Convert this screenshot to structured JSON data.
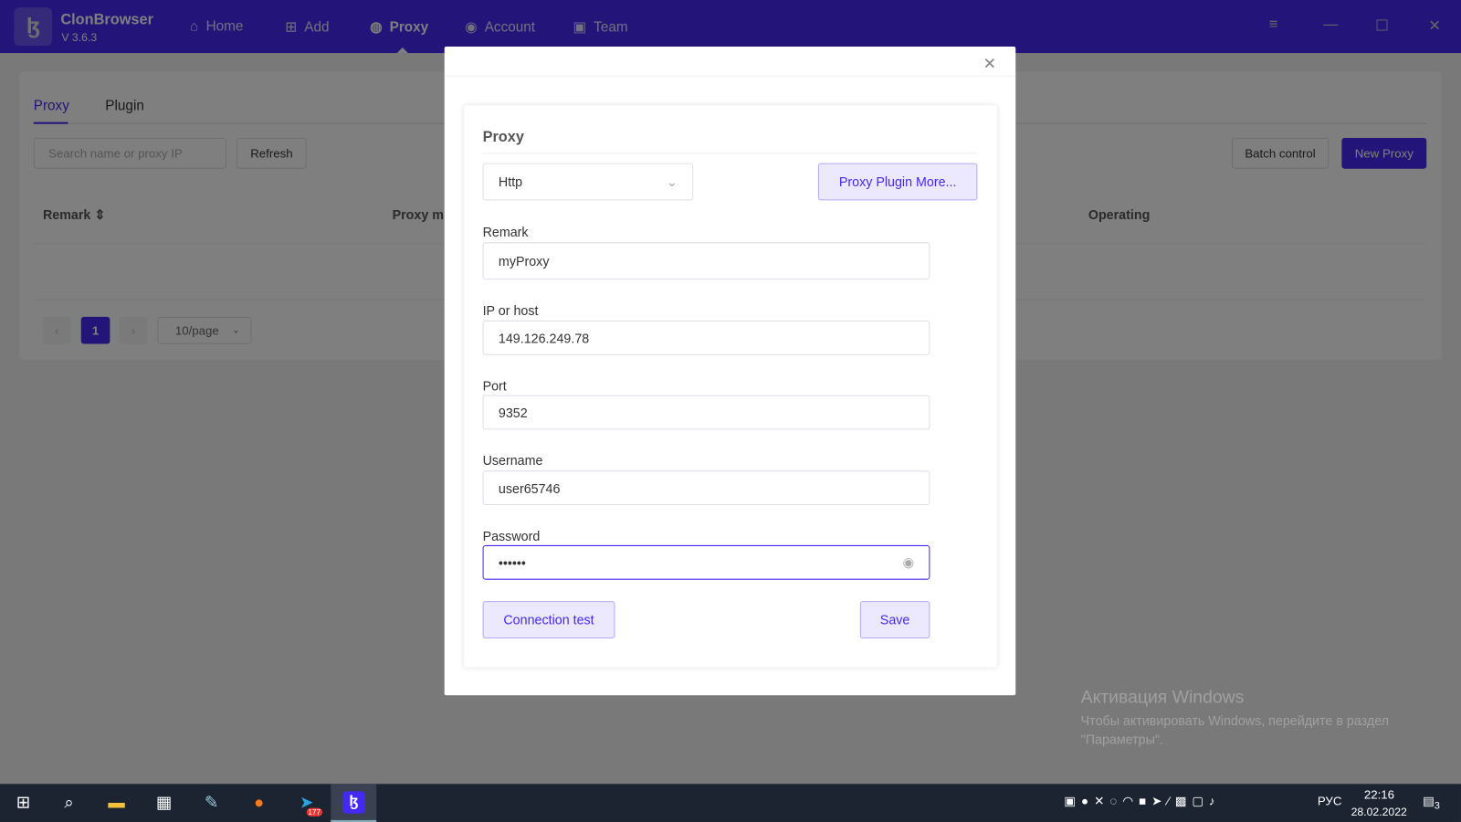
{
  "app": {
    "name": "ClonBrowser",
    "version": "V 3.6.3"
  },
  "nav": [
    {
      "label": "Home",
      "icon": "home-icon"
    },
    {
      "label": "Add",
      "icon": "plus-square-icon"
    },
    {
      "label": "Proxy",
      "icon": "globe-icon",
      "active": true
    },
    {
      "label": "Account",
      "icon": "user-circle-icon"
    },
    {
      "label": "Team",
      "icon": "contact-book-icon"
    }
  ],
  "tabs": [
    {
      "label": "Proxy",
      "active": true
    },
    {
      "label": "Plugin"
    }
  ],
  "toolbar": {
    "search_placeholder": "Search name or proxy IP",
    "refresh": "Refresh",
    "batch": "Batch control",
    "new_proxy": "New Proxy"
  },
  "table": {
    "columns": [
      "Remark",
      "Proxy m",
      "Operating"
    ]
  },
  "pagination": {
    "page": "1",
    "page_size": "10/page"
  },
  "dialog": {
    "section": "Proxy",
    "type": "Http",
    "plugin_btn": "Proxy Plugin More...",
    "remark_label": "Remark",
    "remark": "myProxy",
    "ip_label": "IP or host",
    "ip": "149.126.249.78",
    "port_label": "Port",
    "port": "9352",
    "user_label": "Username",
    "user": "user65746",
    "pass_label": "Password",
    "pass": "••••••",
    "test": "Connection test",
    "save": "Save"
  },
  "watermark": {
    "title": "Активация Windows",
    "text1": "Чтобы активировать Windows, перейдите в раздел",
    "text2": "\"Параметры\"."
  },
  "taskbar": {
    "lang": "РУС",
    "time": "22:16",
    "date": "28.02.2022",
    "telegram_badge": "177",
    "notif": "3"
  },
  "colors": {
    "accent": "#4429f2"
  }
}
